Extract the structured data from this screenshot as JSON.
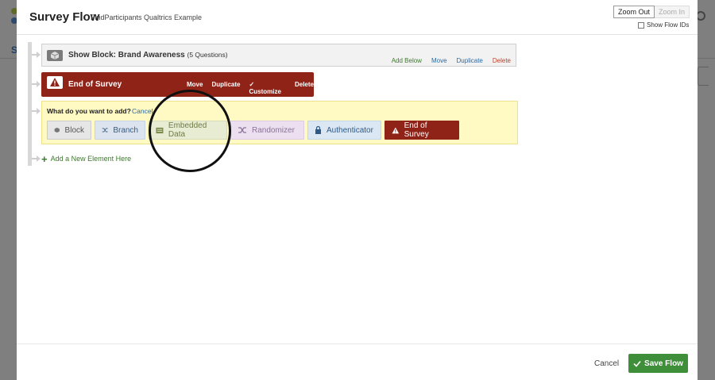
{
  "background": {
    "tab_label": "S"
  },
  "modal": {
    "title": "Survey Flow",
    "subtitle": "FindParticipants Qualtrics Example",
    "zoom_out": "Zoom Out",
    "zoom_in": "Zoom In",
    "show_flow_ids": "Show Flow IDs"
  },
  "flow": {
    "block": {
      "title": "Show Block: Brand Awareness",
      "question_count": "(5 Questions)",
      "actions": {
        "add_below": "Add Below",
        "move": "Move",
        "duplicate": "Duplicate",
        "delete": "Delete"
      }
    },
    "end_of_survey": {
      "title": "End of Survey",
      "actions": {
        "move": "Move",
        "duplicate": "Duplicate",
        "customize": "✓ Customize",
        "delete": "Delete"
      }
    },
    "add_panel": {
      "question": "What do you want to add?",
      "cancel": "Cancel",
      "options": {
        "block": "Block",
        "branch": "Branch",
        "embedded_data": "Embedded Data",
        "randomizer": "Randomizer",
        "authenticator": "Authenticator",
        "end_of_survey": "End of Survey"
      }
    },
    "add_new": "Add a New Element Here"
  },
  "footer": {
    "cancel": "Cancel",
    "save": "Save Flow"
  },
  "colors": {
    "end_of_survey": "#8f2318",
    "save": "#3f8f3a",
    "add_panel": "#fff9c4",
    "link": "#2b6aa3"
  }
}
